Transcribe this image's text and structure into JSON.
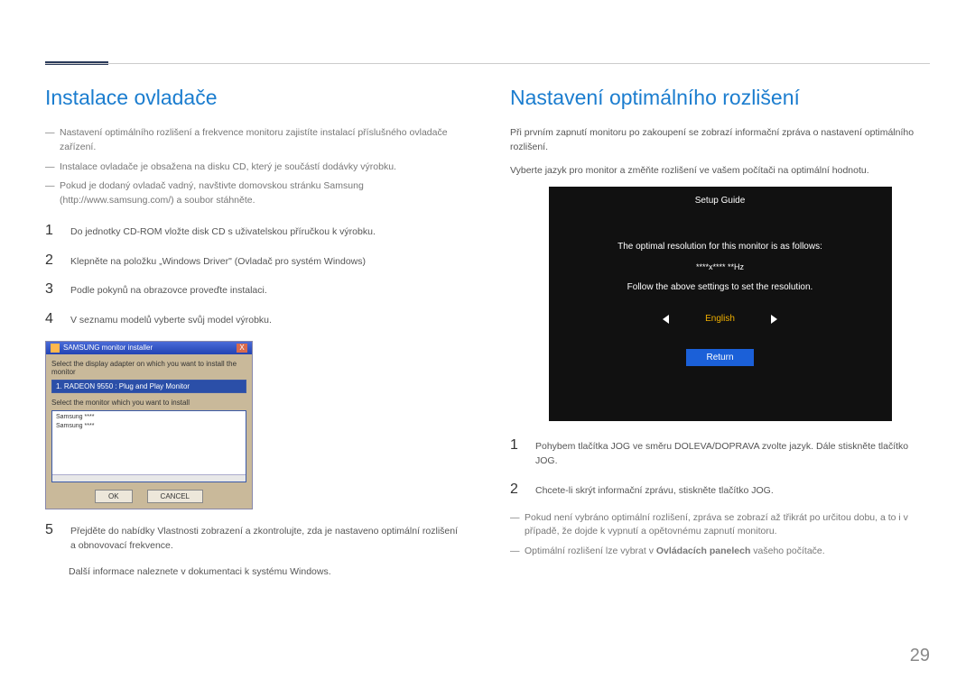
{
  "page_number": "29",
  "left": {
    "heading": "Instalace ovladače",
    "intro": [
      "Nastavení optimálního rozlišení a frekvence monitoru zajistíte instalací příslušného ovladače zařízení.",
      "Instalace ovladače je obsažena na disku CD, který je součástí dodávky výrobku.",
      "Pokud je dodaný ovladač vadný, navštivte domovskou stránku Samsung (http://www.samsung.com/) a soubor stáhněte."
    ],
    "steps": {
      "s1": "Do jednotky CD-ROM vložte disk CD s uživatelskou příručkou k výrobku.",
      "s2": "Klepněte na položku „Windows Driver\" (Ovladač pro systém Windows)",
      "s3": "Podle pokynů na obrazovce proveďte instalaci.",
      "s4": "V seznamu modelů vyberte svůj model výrobku.",
      "s5": "Přejděte do nabídky Vlastnosti zobrazení a zkontrolujte, zda je nastaveno optimální rozlišení a obnovovací frekvence."
    },
    "note": "Další informace naleznete v dokumentaci k systému Windows.",
    "installer": {
      "title": "SAMSUNG monitor installer",
      "instr1": "Select the display adapter on which you want to install the monitor",
      "adapter": "1. RADEON 9550 : Plug and Play Monitor",
      "instr2": "Select the monitor which you want to install",
      "list_item1": "Samsung ****",
      "list_item2": "Samsung ****",
      "ok": "OK",
      "cancel": "CANCEL"
    }
  },
  "right": {
    "heading": "Nastavení optimálního rozlišení",
    "body1": "Při prvním zapnutí monitoru po zakoupení se zobrazí informační zpráva o nastavení optimálního rozlišení.",
    "body2": "Vyberte jazyk pro monitor a změňte rozlišení ve vašem počítači na optimální hodnotu.",
    "setup": {
      "title": "Setup Guide",
      "line1": "The optimal resolution for this monitor is as follows:",
      "res": "****x**** **Hz",
      "line2": "Follow the above settings to set the resolution.",
      "lang": "English",
      "return": "Return"
    },
    "steps": {
      "s1": "Pohybem tlačítka JOG ve směru DOLEVA/DOPRAVA zvolte jazyk. Dále stiskněte tlačítko JOG.",
      "s2": "Chcete-li skrýt informační zprávu, stiskněte tlačítko JOG."
    },
    "outro": [
      "Pokud není vybráno optimální rozlišení, zpráva se zobrazí až třikrát po určitou dobu, a to i v případě, že dojde k vypnutí a opětovnému zapnutí monitoru.",
      "Optimální rozlišení lze vybrat v "
    ],
    "outro_bold": "Ovládacích panelech",
    "outro_tail": " vašeho počítače."
  }
}
